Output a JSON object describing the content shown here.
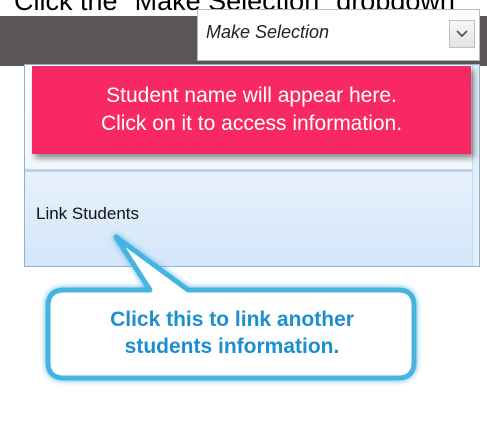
{
  "header": {
    "instruction": "Click the \"Make Selection\" dropdown"
  },
  "selector": {
    "value": "Make Selection"
  },
  "note": {
    "line1": "Student name will appear here.",
    "line2": "Click on it to access information."
  },
  "menu": {
    "link_students": "Link Students"
  },
  "callout": {
    "line1": "Click this to link another",
    "line2": "students information."
  },
  "colors": {
    "dark_bar": "#5a5656",
    "note_background": "#f72862",
    "callout_text": "#1c8fd0",
    "callout_border": "#45b4e0"
  },
  "icons": {
    "dropdown_arrow": "chevron-down-icon"
  }
}
